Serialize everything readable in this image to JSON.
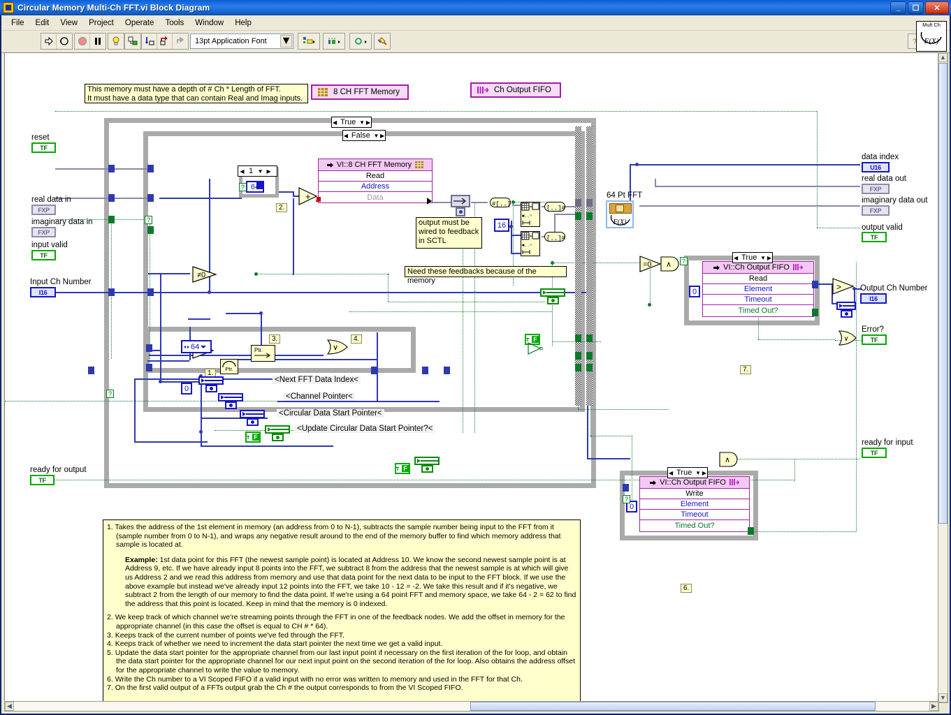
{
  "window": {
    "title": "Circular Memory Multi-Ch FFT.vi Block Diagram",
    "icon": "labview-vi-icon",
    "minimize": "_",
    "maximize": "□",
    "close": "✕"
  },
  "menu": [
    "File",
    "Edit",
    "View",
    "Project",
    "Operate",
    "Tools",
    "Window",
    "Help"
  ],
  "toolbar": {
    "font_selector": "13pt Application Font",
    "buttons": [
      {
        "name": "run-button",
        "icon": "run-arrow-icon"
      },
      {
        "name": "run-continuously-button",
        "icon": "run-continuous-icon"
      },
      {
        "name": "abort-button",
        "icon": "abort-stop-icon"
      },
      {
        "name": "pause-button",
        "icon": "pause-icon"
      },
      {
        "name": "highlight-execution-button",
        "icon": "lightbulb-icon"
      },
      {
        "name": "retain-wire-values-button",
        "icon": "retain-wire-values-icon"
      },
      {
        "name": "step-into-button",
        "icon": "step-into-icon"
      },
      {
        "name": "step-over-button",
        "icon": "step-over-icon"
      },
      {
        "name": "step-out-button",
        "icon": "step-out-icon"
      },
      {
        "name": "align-objects-button",
        "icon": "align-objects-icon"
      },
      {
        "name": "distribute-objects-button",
        "icon": "distribute-objects-icon"
      },
      {
        "name": "reorder-button",
        "icon": "reorder-icon"
      },
      {
        "name": "clean-up-diagram-button",
        "icon": "cleanup-diagram-icon"
      }
    ],
    "help_icon": "context-help-icon",
    "vi_icon_top": "Mult Ch",
    "vi_icon_bottom": "F(X)"
  },
  "diagram": {
    "controls": [
      {
        "name": "reset",
        "label": "reset",
        "type": "TF"
      },
      {
        "name": "real-data-in",
        "label": "real data in",
        "type": "FXP"
      },
      {
        "name": "imaginary-data-in",
        "label": "imaginary data in",
        "type": "FXP"
      },
      {
        "name": "input-valid",
        "label": "input valid",
        "type": "TF"
      },
      {
        "name": "input-ch-number",
        "label": "Input Ch Number",
        "type": "I16"
      },
      {
        "name": "ready-for-output",
        "label": "ready for output",
        "type": "TF"
      }
    ],
    "indicators": [
      {
        "name": "data-index",
        "label": "data index",
        "type": "U16"
      },
      {
        "name": "real-data-out",
        "label": "real data out",
        "type": "FXP"
      },
      {
        "name": "imaginary-data-out",
        "label": "imaginary data out",
        "type": "FXP"
      },
      {
        "name": "output-valid",
        "label": "output valid",
        "type": "TF"
      },
      {
        "name": "output-ch-number",
        "label": "Output Ch Number",
        "type": "I16"
      },
      {
        "name": "error-q",
        "label": "Error?",
        "type": "TF"
      },
      {
        "name": "ready-for-input",
        "label": "ready for input",
        "type": "TF"
      }
    ],
    "resource_bars": [
      {
        "name": "memory-resource",
        "label": "8 CH FFT Memory",
        "icon": "memory-grid-icon"
      },
      {
        "name": "fifo-resource",
        "label": "Ch Output FIFO",
        "icon": "fifo-bars-icon"
      }
    ],
    "subvis": [
      {
        "name": "memory-read-node",
        "title": "VI::8 CH FFT Memory",
        "icon": "memory-grid-icon",
        "method": "Read",
        "rows": [
          "Address",
          "Data"
        ]
      },
      {
        "name": "fifo-read-node",
        "title": "VI::Ch Output FIFO",
        "icon": "fifo-bars-icon",
        "method": "Read",
        "rows": [
          "Element",
          "Timeout",
          "Timed Out?"
        ]
      },
      {
        "name": "fifo-write-node",
        "title": "VI::Ch Output FIFO",
        "icon": "fifo-bars-icon",
        "method": "Write",
        "rows": [
          "Element",
          "Timeout",
          "Timed Out?"
        ]
      }
    ],
    "case_selectors": [
      {
        "name": "outer-case-selector",
        "value": "True"
      },
      {
        "name": "inner-case-selector",
        "value": "False"
      },
      {
        "name": "fifo-read-case-selector",
        "value": "True"
      },
      {
        "name": "fifo-write-case-selector",
        "value": "True"
      },
      {
        "name": "for-loop-count-selector",
        "value": "1"
      }
    ],
    "constants": [
      {
        "name": "fft-length-constant-64a",
        "value": "64"
      },
      {
        "name": "ch-offset-constant-64b",
        "value": "64"
      },
      {
        "name": "fifo-read-timeout-constant",
        "value": "0"
      },
      {
        "name": "fifo-write-timeout-constant",
        "value": "0"
      },
      {
        "name": "channel-pointer-init-constant",
        "value": "0"
      },
      {
        "name": "fft-size-constant-16",
        "value": "16"
      },
      {
        "name": "update-pointer-false-constant",
        "value": "F"
      }
    ],
    "notes": [
      {
        "name": "memory-depth-note",
        "lines": [
          "This memory must have a depth of # Ch * Length of FFT.",
          "It must have a data type that can contain Real and Imag inputs."
        ]
      },
      {
        "name": "output-feedback-note",
        "lines": [
          "output must be",
          "wired to feedback",
          "in SCTL"
        ]
      },
      {
        "name": "feedback-memory-note",
        "lines": [
          "Need these feedbacks because of the memory"
        ]
      }
    ],
    "fft_label": "64 Pt FFT",
    "shift_register_labels": [
      "<Next FFT Data Index<",
      "<Channel Pointer<",
      "<Circular Data Start Pointer<",
      "<Update Circular Data Start Pointer?<"
    ],
    "number_tags": [
      "1.",
      "2.",
      "3.",
      "4.",
      "6.",
      "7."
    ],
    "functions": [
      {
        "name": "add-function",
        "glyph": "+"
      },
      {
        "name": "subtract-function",
        "glyph": "−"
      },
      {
        "name": "not-equal-zero-function",
        "glyph": "≠0"
      },
      {
        "name": "equal-zero-function-a",
        "glyph": "=0"
      },
      {
        "name": "equal-zero-function-b",
        "glyph": "=0"
      },
      {
        "name": "and-function-a",
        "glyph": "∧"
      },
      {
        "name": "or-function",
        "glyph": "∨"
      },
      {
        "name": "and-function-b",
        "glyph": "∧"
      },
      {
        "name": "or-function-error",
        "glyph": "∨"
      },
      {
        "name": "greater-than-function",
        "glyph": ">"
      }
    ]
  },
  "legend": {
    "items": [
      {
        "num": "1.",
        "text": "Takes the address of the 1st element in memory (an address from 0 to N-1), subtracts the sample number being input to the FFT from it (sample number from 0 to N-1), and wraps any negative result around to the end of the memory buffer to find which memory address that sample is located at."
      },
      {
        "num": "2.",
        "text": "We keep track of which channel we're streaming points through the FFT in one of the feedback nodes. We add the offset in memory for the appropriate channel (in this case the offset is equal to CH # * 64)."
      },
      {
        "num": "3.",
        "text": "Keeps track of the current number of points we've fed through the FFT."
      },
      {
        "num": "4.",
        "text": "Keeps track of whether we need to increment the data start pointer the next time we get a valid input."
      },
      {
        "num": "5.",
        "text": "Update the data start pointer for the appropriate channel from our last input point if necessary on the first iteration of the for loop, and obtain the data start pointer for the appropriate channel for our next input point on the second iteration of the for loop. Also obtains the address offset for the appropriate channel to write the value to memory."
      },
      {
        "num": "6.",
        "text": "Write the Ch number to a VI Scoped FIFO if a valid input with no error was written to memory and used in the FFT for that Ch."
      },
      {
        "num": "7.",
        "text": "On the first valid output of a FFTs output grab the Ch # the output corresponds to from the VI Scoped FIFO."
      }
    ],
    "example_bold": "Example:",
    "example_text": " 1st data point for this FFT (the newest sample point) is located at Address 10. We know the second newest sample point is at Address 9, etc. If we have already input 8 points into the FFT, we subtract 8 from the address that the newest sample is at which will give us Address 2 and we read this address from memory and use that data point for the next data to be input to the FFT block. If we use the above example but instead we've already input 12 points into the FFT, we take 10 - 12 = -2. We take this result and if it's negative, we subtract 2 from the length of our memory to find the data point. If we're using a 64 point FFT and memory space, we take 64 - 2 = 62 to find the address that this point is located. Keep in mind that the memory is 0 indexed."
  },
  "colors": {
    "title_blue": "#1464da",
    "window_bg": "#ece9d8",
    "wire_blue": "#2d39b0",
    "wire_green": "#0a7a2a",
    "subvi_pink": "#f3c8f3",
    "subvi_border": "#a020a0",
    "note_yellow": "#ffffcc"
  }
}
